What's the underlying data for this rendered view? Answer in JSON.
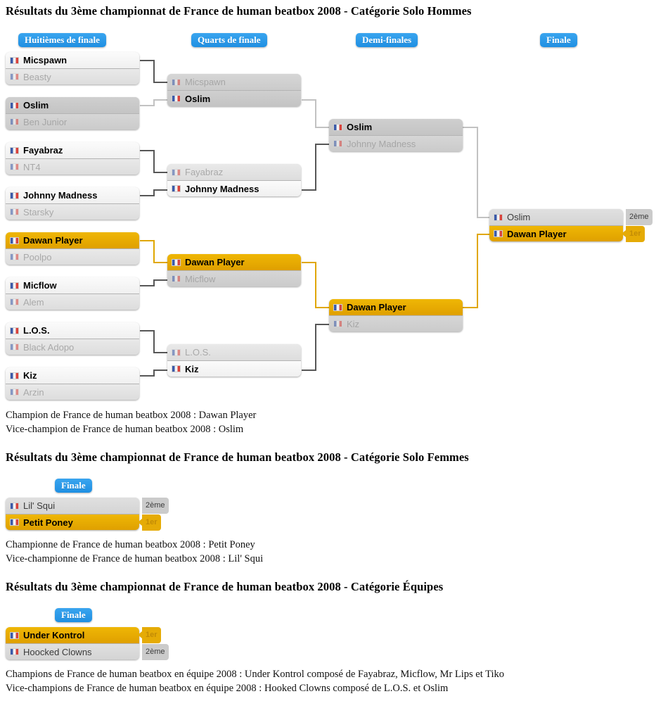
{
  "sections": [
    {
      "title": "Résultats du 3ème championnat de France de human beatbox 2008 - Catégorie Solo Hommes",
      "rounds": [
        "Huitièmes de finale",
        "Quarts de finale",
        "Demi-finales",
        "Finale"
      ],
      "captions": [
        "Champion de France de human beatbox 2008 : Dawan Player",
        "Vice-champion de France de human beatbox 2008 : Oslim"
      ]
    },
    {
      "title": "Résultats du 3ème championnat de France de human beatbox 2008 - Catégorie Solo Femmes",
      "rounds": [
        "Finale"
      ],
      "captions": [
        "Championne de France de human beatbox 2008 : Petit Poney",
        "Vice-championne de France de human beatbox 2008 : Lil' Squi"
      ]
    },
    {
      "title": "Résultats du 3ème championnat de France de human beatbox 2008 - Catégorie Équipes",
      "rounds": [
        "Finale"
      ],
      "captions": [
        "Champions de France de human beatbox en équipe 2008 : Under Kontrol composé de Fayabraz, Micflow, Mr Lips et Tiko",
        "Vice-champions de France de human beatbox en équipe 2008 : Hooked Clowns composé de L.O.S. et Oslim"
      ]
    }
  ],
  "colors": {
    "round_label_bg": "#2e9bea",
    "winner_gold": "#dfa000",
    "badge_first": "#e5ab06",
    "badge_second": "#cbcbcb",
    "line_dark": "#575757",
    "line_gray": "#c2c2c2",
    "line_gold": "#e0a700"
  },
  "badges": {
    "first": "1er",
    "second": "2ème"
  },
  "men": {
    "r16": [
      {
        "top": "Micspawn",
        "bottom": "Beasty"
      },
      {
        "top": "Oslim",
        "bottom": "Ben Junior"
      },
      {
        "top": "Fayabraz",
        "bottom": "NT4"
      },
      {
        "top": "Johnny Madness",
        "bottom": "Starsky"
      },
      {
        "top": "Dawan Player",
        "bottom": "Poolpo"
      },
      {
        "top": "Micflow",
        "bottom": "Alem"
      },
      {
        "top": "L.O.S.",
        "bottom": "Black Adopo"
      },
      {
        "top": "Kiz",
        "bottom": "Arzin"
      }
    ],
    "qf": [
      {
        "top": "Micspawn",
        "bottom": "Oslim"
      },
      {
        "top": "Fayabraz",
        "bottom": "Johnny Madness"
      },
      {
        "top": "Dawan Player",
        "bottom": "Micflow"
      },
      {
        "top": "L.O.S.",
        "bottom": "Kiz"
      }
    ],
    "sf": [
      {
        "top": "Oslim",
        "bottom": "Johnny Madness"
      },
      {
        "top": "Dawan Player",
        "bottom": "Kiz"
      }
    ],
    "final": {
      "top": "Oslim",
      "bottom": "Dawan Player"
    }
  },
  "women": {
    "final": {
      "top": "Lil' Squi",
      "bottom": "Petit Poney"
    }
  },
  "teams": {
    "final": {
      "top": "Under Kontrol",
      "bottom": "Hoocked Clowns"
    }
  }
}
